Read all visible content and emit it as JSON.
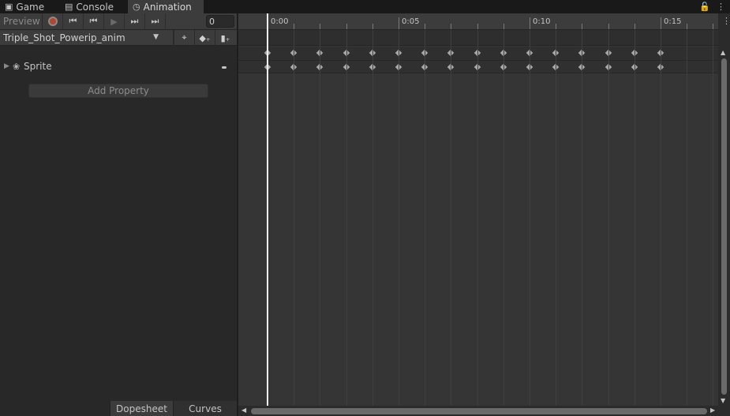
{
  "tabs": [
    {
      "label": "Game",
      "icon": "gamepad-icon"
    },
    {
      "label": "Console",
      "icon": "console-icon"
    },
    {
      "label": "Animation",
      "icon": "clock-icon",
      "active": true
    }
  ],
  "toolbar": {
    "preview_label": "Preview",
    "frame_value": "0",
    "record_color": "#b5452f"
  },
  "clip": {
    "name": "Triple_Shot_Powerip_anim"
  },
  "properties": [
    {
      "label": "Sprite"
    }
  ],
  "add_property_label": "Add Property",
  "bottom_tabs": {
    "dopesheet": "Dopesheet",
    "curves": "Curves"
  },
  "timeline": {
    "ruler_labels": [
      "0:00",
      "0:05",
      "0:10",
      "0:15"
    ],
    "keyframe_count": 16
  },
  "colors": {
    "background": "#282828",
    "panel": "#3c3c3c",
    "timeline_bg": "#353535",
    "keyframe": "#a8a8a8",
    "playhead": "#f0f0f0"
  }
}
